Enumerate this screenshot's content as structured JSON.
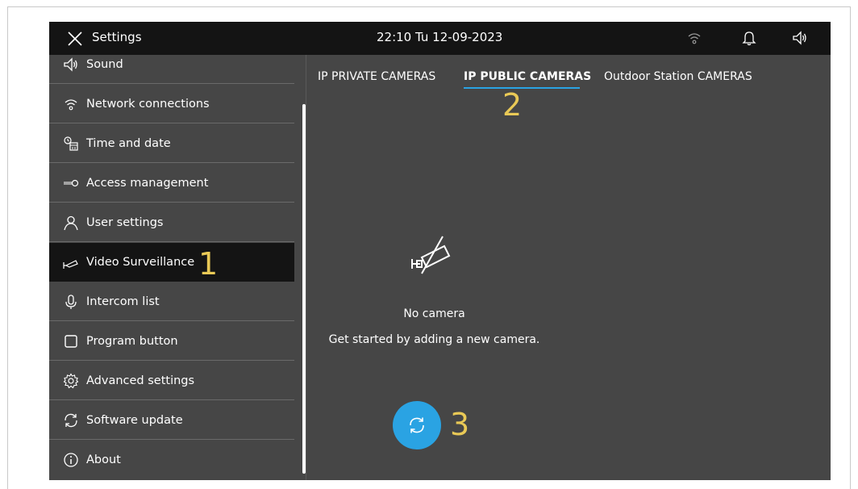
{
  "header": {
    "title": "Settings",
    "datetime": "22:10  Tu 12-09-2023"
  },
  "sidebar": {
    "items": [
      {
        "label": "Sound",
        "icon": "speaker-icon"
      },
      {
        "label": "Network connections",
        "icon": "wifi-icon"
      },
      {
        "label": "Time and date",
        "icon": "clock-calendar-icon"
      },
      {
        "label": "Access  management",
        "icon": "key-icon"
      },
      {
        "label": "User settings",
        "icon": "user-icon"
      },
      {
        "label": "Video Surveillance",
        "icon": "camera-icon",
        "active": true
      },
      {
        "label": "Intercom list",
        "icon": "microphone-icon"
      },
      {
        "label": "Program button",
        "icon": "square-icon"
      },
      {
        "label": "Advanced settings",
        "icon": "gear-icon"
      },
      {
        "label": "Software update",
        "icon": "refresh-icon"
      },
      {
        "label": "About",
        "icon": "info-icon"
      }
    ]
  },
  "tabs": [
    {
      "label": "IP PRIVATE CAMERAS"
    },
    {
      "label": "IP PUBLIC CAMERAS",
      "active": true
    },
    {
      "label": "Outdoor Station CAMERAS"
    }
  ],
  "empty_state": {
    "title": "No camera",
    "subtitle": "Get started by adding a new camera."
  },
  "markers": [
    "1",
    "2",
    "3"
  ],
  "colors": {
    "accent": "#2aa3e3",
    "topbar": "#141414",
    "panel": "#464646",
    "marker": "#e9c956"
  }
}
